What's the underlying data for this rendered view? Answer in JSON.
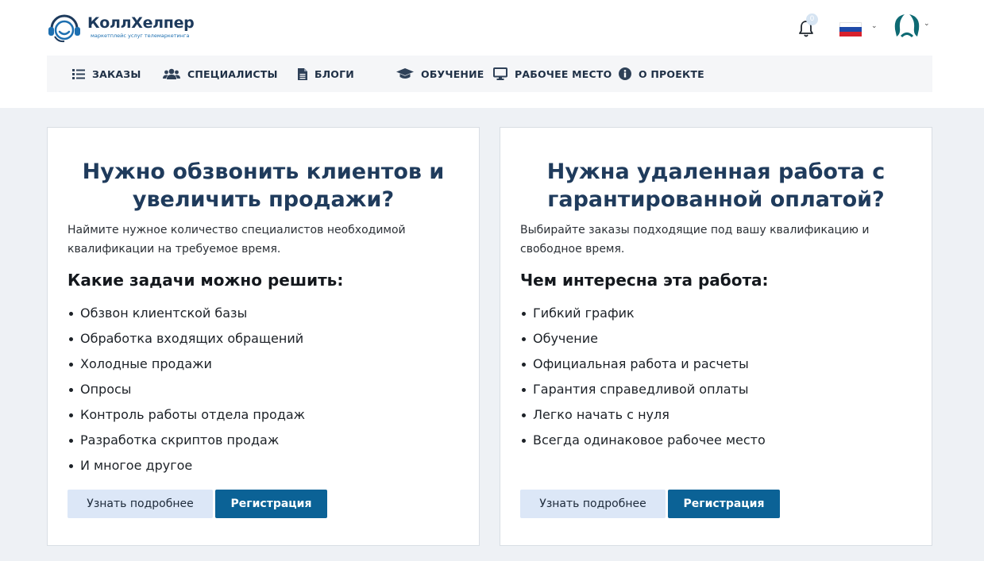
{
  "brand": {
    "name": "КоллХелпер",
    "tagline": "маркетплейс услуг телемаркетинга"
  },
  "header": {
    "notifications_count": "0",
    "language_flag": "russian-flag",
    "colors": {
      "brand_dark": "#1d3a5c",
      "brand_teal": "#0e6a73",
      "accent": "#0b6296"
    }
  },
  "nav": {
    "items": [
      {
        "label": "ЗАКАЗЫ",
        "icon": "list-icon"
      },
      {
        "label": "СПЕЦИАЛИСТЫ",
        "icon": "users-icon"
      },
      {
        "label": "БЛОГИ",
        "icon": "document-icon"
      },
      {
        "label": "ОБУЧЕНИЕ",
        "icon": "graduation-cap-icon"
      },
      {
        "label": "РАБОЧЕЕ МЕСТО",
        "icon": "monitor-icon"
      },
      {
        "label": "О ПРОЕКТЕ",
        "icon": "info-icon"
      }
    ]
  },
  "cards": [
    {
      "title": "Нужно обзвонить клиентов и увеличить продажи?",
      "description": "Наймите нужное количество специалистов необходимой квалификации на требуемое время.",
      "subtitle": "Какие задачи можно решить:",
      "items": [
        "Обзвон клиентской базы",
        "Обработка входящих обращений",
        "Холодные продажи",
        "Опросы",
        "Контроль работы отдела продаж",
        "Разработка скриптов продаж",
        "И многое другое"
      ],
      "more_label": "Узнать подробнее",
      "register_label": "Регистрация"
    },
    {
      "title": "Нужна удаленная работа с гарантированной оплатой?",
      "description": "Выбирайте заказы подходящие под вашу квалификацию и свободное время.",
      "subtitle": "Чем интересна эта работа:",
      "items": [
        "Гибкий график",
        "Обучение",
        "Официальная работа и расчеты",
        "Гарантия справедливой оплаты",
        "Легко начать с нуля",
        "Всегда одинаковое рабочее место"
      ],
      "more_label": "Узнать подробнее",
      "register_label": "Регистрация"
    }
  ]
}
